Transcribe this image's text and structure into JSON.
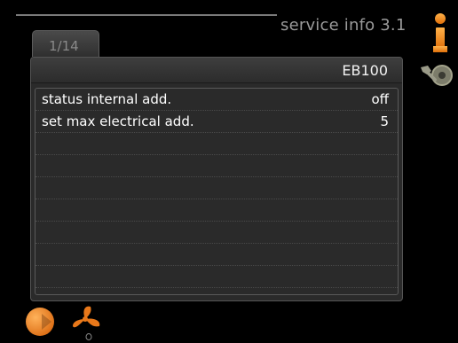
{
  "header": {
    "title": "service info 3.1"
  },
  "tab": {
    "label": "1/14"
  },
  "panel": {
    "header": "EB100",
    "rows": [
      {
        "label": "status internal add.",
        "value": "off"
      },
      {
        "label": "set max electrical add.",
        "value": "5"
      },
      {
        "label": "",
        "value": ""
      },
      {
        "label": "",
        "value": ""
      },
      {
        "label": "",
        "value": ""
      },
      {
        "label": "",
        "value": ""
      },
      {
        "label": "",
        "value": ""
      },
      {
        "label": "",
        "value": ""
      },
      {
        "label": "",
        "value": ""
      },
      {
        "label": "",
        "value": ""
      }
    ]
  },
  "icons": {
    "info": "info-icon",
    "tools": "tools-icon",
    "home": "home-icon",
    "fan": "fan-icon"
  },
  "colors": {
    "accent_orange": "#f08a1c",
    "background": "#000000",
    "panel": "#2a2a2a"
  }
}
